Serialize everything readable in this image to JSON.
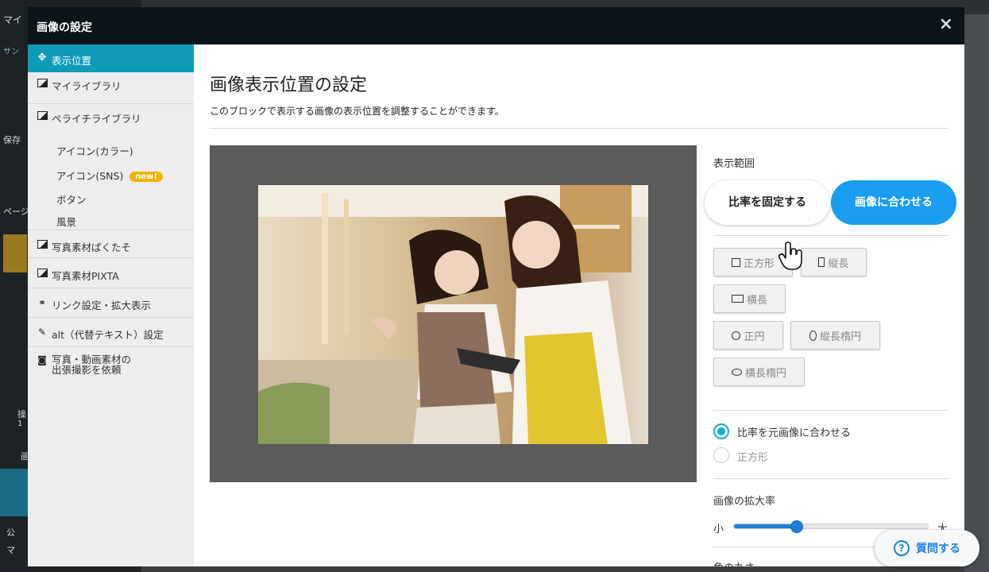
{
  "background": {
    "fragments": [
      "マイ",
      "サン",
      "保存",
      "ページ",
      "操",
      "1",
      "画",
      "公",
      "マ"
    ]
  },
  "modal": {
    "title": "画像の設定",
    "close_label": "×"
  },
  "sidebar": {
    "items": [
      {
        "label": "表示位置",
        "icon": "move-icon",
        "active": true
      },
      {
        "label": "マイライブラリ",
        "icon": "image-icon"
      },
      {
        "label": "ペライチライブラリ",
        "icon": "image-icon"
      },
      {
        "label": "写真素材ぱくたそ",
        "icon": "image-icon"
      },
      {
        "label": "写真素材PIXTA",
        "icon": "image-icon"
      },
      {
        "label": "リンク設定・拡大表示",
        "icon": "link-icon"
      },
      {
        "label": "alt（代替テキスト）設定",
        "icon": "pencil-icon"
      },
      {
        "label_line1": "写真・動画素材の",
        "label_line2": "出張撮影を依頼",
        "icon": "camera-icon"
      }
    ],
    "subitems": [
      {
        "label": "アイコン(カラー)"
      },
      {
        "label": "アイコン(SNS)",
        "badge": "new!"
      },
      {
        "label": "ボタン"
      },
      {
        "label": "風景"
      }
    ]
  },
  "content": {
    "title": "画像表示位置の設定",
    "description": "このブロックで表示する画像の表示位置を調整することができます。"
  },
  "panel": {
    "range_label": "表示範囲",
    "fix_ratio_label": "比率を固定する",
    "fit_image_label": "画像に合わせる",
    "shapes": {
      "square": "正方形",
      "portrait": "縦長",
      "landscape": "横長",
      "circle": "正円",
      "vertical_ellipse": "縦長楕円",
      "horizontal_ellipse": "横長楕円"
    },
    "radio_options": [
      {
        "label": "比率を元画像に合わせる",
        "selected": true
      },
      {
        "label": "正方形",
        "selected": false
      }
    ],
    "zoom_label": "画像の拡大率",
    "zoom_small": "小",
    "zoom_large": "大",
    "zoom_value": 0.32,
    "corner_label": "角の丸さ"
  },
  "help": {
    "label": "質問する"
  },
  "colors": {
    "accent": "#0f9bb8",
    "primary_blue": "#1a9cf0",
    "badge": "#f4b400",
    "header": "#0b1519"
  }
}
